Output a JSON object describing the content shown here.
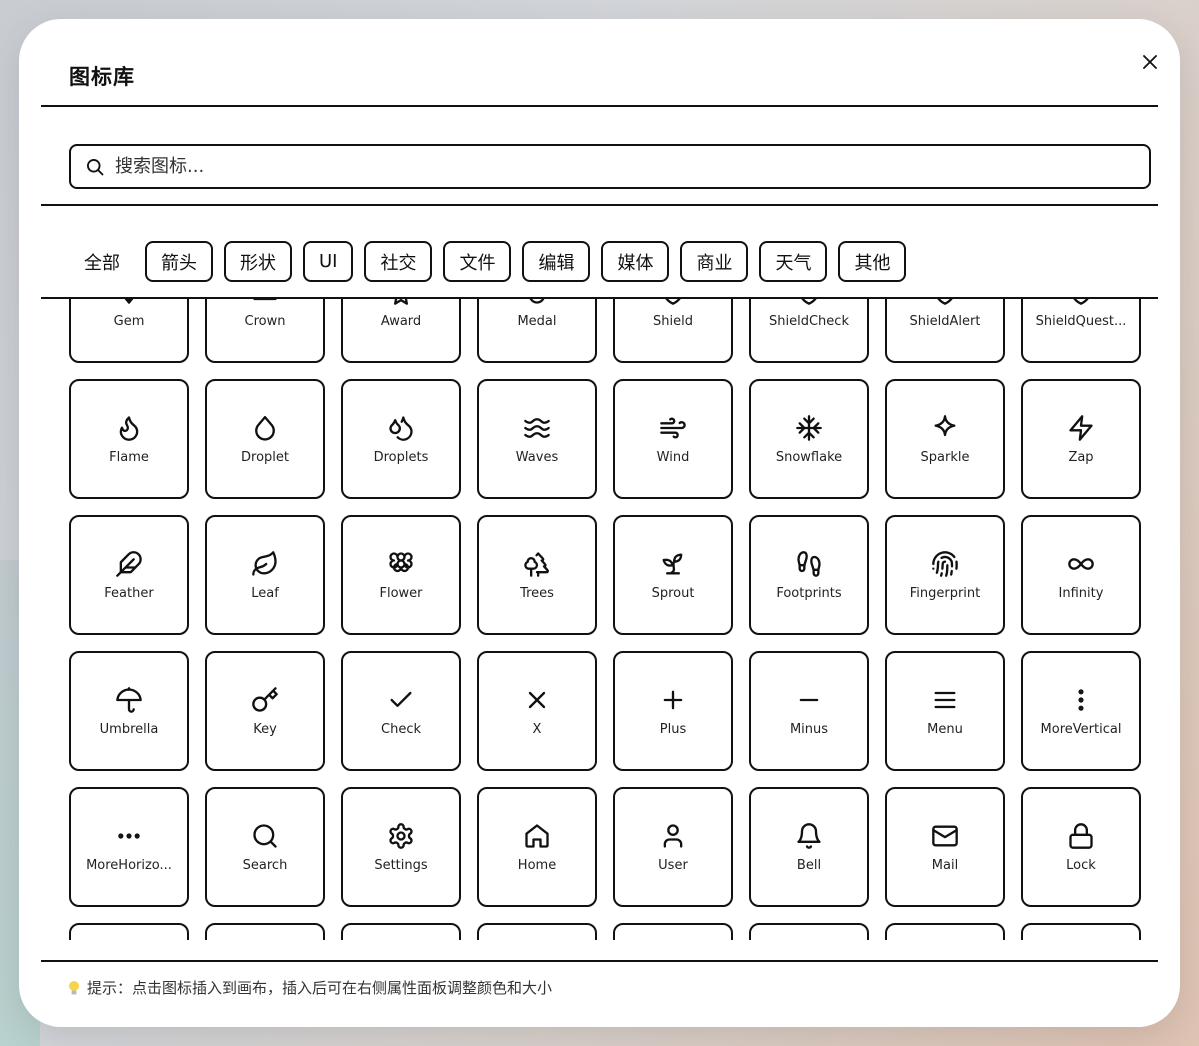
{
  "dialog": {
    "title": "图标库",
    "close_label": "×"
  },
  "search": {
    "placeholder": "搜索图标..."
  },
  "categories": {
    "all": "全部",
    "items": [
      "箭头",
      "形状",
      "UI",
      "社交",
      "文件",
      "编辑",
      "媒体",
      "商业",
      "天气",
      "其他"
    ]
  },
  "icons": [
    {
      "label": "Gem",
      "icon": "gem-icon"
    },
    {
      "label": "Crown",
      "icon": "crown-icon"
    },
    {
      "label": "Award",
      "icon": "award-icon"
    },
    {
      "label": "Medal",
      "icon": "medal-icon"
    },
    {
      "label": "Shield",
      "icon": "shield-icon"
    },
    {
      "label": "ShieldCheck",
      "icon": "shield-check-icon"
    },
    {
      "label": "ShieldAlert",
      "icon": "shield-alert-icon"
    },
    {
      "label": "ShieldQuest...",
      "icon": "shield-question-icon"
    },
    {
      "label": "Flame",
      "icon": "flame-icon"
    },
    {
      "label": "Droplet",
      "icon": "droplet-icon"
    },
    {
      "label": "Droplets",
      "icon": "droplets-icon"
    },
    {
      "label": "Waves",
      "icon": "waves-icon"
    },
    {
      "label": "Wind",
      "icon": "wind-icon"
    },
    {
      "label": "Snowflake",
      "icon": "snowflake-icon"
    },
    {
      "label": "Sparkle",
      "icon": "sparkle-icon"
    },
    {
      "label": "Zap",
      "icon": "zap-icon"
    },
    {
      "label": "Feather",
      "icon": "feather-icon"
    },
    {
      "label": "Leaf",
      "icon": "leaf-icon"
    },
    {
      "label": "Flower",
      "icon": "flower-icon"
    },
    {
      "label": "Trees",
      "icon": "trees-icon"
    },
    {
      "label": "Sprout",
      "icon": "sprout-icon"
    },
    {
      "label": "Footprints",
      "icon": "footprints-icon"
    },
    {
      "label": "Fingerprint",
      "icon": "fingerprint-icon"
    },
    {
      "label": "Infinity",
      "icon": "infinity-icon"
    },
    {
      "label": "Umbrella",
      "icon": "umbrella-icon"
    },
    {
      "label": "Key",
      "icon": "key-icon"
    },
    {
      "label": "Check",
      "icon": "check-icon"
    },
    {
      "label": "X",
      "icon": "x-icon"
    },
    {
      "label": "Plus",
      "icon": "plus-icon"
    },
    {
      "label": "Minus",
      "icon": "minus-icon"
    },
    {
      "label": "Menu",
      "icon": "menu-icon"
    },
    {
      "label": "MoreVertical",
      "icon": "more-vertical-icon"
    },
    {
      "label": "MoreHorizo...",
      "icon": "more-horizontal-icon"
    },
    {
      "label": "Search",
      "icon": "search-icon"
    },
    {
      "label": "Settings",
      "icon": "settings-icon"
    },
    {
      "label": "Home",
      "icon": "home-icon"
    },
    {
      "label": "User",
      "icon": "user-icon"
    },
    {
      "label": "Bell",
      "icon": "bell-icon"
    },
    {
      "label": "Mail",
      "icon": "mail-icon"
    },
    {
      "label": "Lock",
      "icon": "lock-icon"
    },
    {
      "label": "",
      "icon": ""
    },
    {
      "label": "",
      "icon": ""
    },
    {
      "label": "",
      "icon": ""
    },
    {
      "label": "",
      "icon": ""
    },
    {
      "label": "",
      "icon": ""
    },
    {
      "label": "",
      "icon": ""
    },
    {
      "label": "",
      "icon": ""
    },
    {
      "label": "",
      "icon": ""
    }
  ],
  "footer": {
    "hint": "提示：点击图标插入到画布，插入后可在右侧属性面板调整颜色和大小",
    "hint_icon": "lightbulb-icon"
  }
}
